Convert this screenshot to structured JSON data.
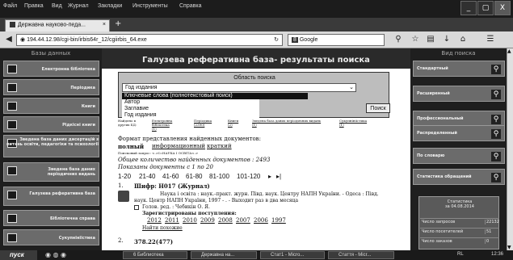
{
  "menubar": {
    "items": [
      "Файл",
      "Правка",
      "Вид",
      "Журнал",
      "Закладки",
      "Инструменты",
      "Справка"
    ],
    "window_buttons": [
      "_",
      "▢",
      "X"
    ]
  },
  "tabs": [
    {
      "label": "Державна науково-педа...",
      "close": "×"
    }
  ],
  "new_tab": "+",
  "address": {
    "url": "194.44.12.98/cgi-bin/irbis64r_12/cgiirbis_64.exe",
    "search_engine": "Google",
    "search_badge": "8"
  },
  "sidebar_left": {
    "title": "Базы данных",
    "items": [
      "Електронна бібліотека",
      "Періодика",
      "Книги",
      "Рідкісні книги",
      "Зведена база даних дисертацій з питань освіти, педагогіки та психології",
      "Зведена база даних періодичних видань",
      "Галузева реферативна база",
      "Бібліотечна справа",
      "Сукупнініістика"
    ]
  },
  "sidebar_right": {
    "title": "Вид поиска",
    "items": [
      "Стандартный",
      "Расширенный",
      "Профессиональный",
      "Распределенный",
      "По словарю",
      "Статистика обращений"
    ],
    "stats": {
      "heading": "Статистика",
      "date": "за 04.08.2014",
      "rows": [
        {
          "label": "Число запросов",
          "value": "22132"
        },
        {
          "label": "Число посетителей",
          "value": "51"
        },
        {
          "label": "Число заказов",
          "value": "0"
        }
      ]
    }
  },
  "main": {
    "title": "Галузева реферативна база- результаты поиска",
    "search_area_label": "Область поиска",
    "select_value": "Год издания",
    "dropdown_options": [
      "Ключевые слова (полнотекстовый поиск)",
      "Автор",
      "Заглавие",
      "Год издания"
    ],
    "search_button": "Поиск",
    "found_label": "Найдено в других БД:",
    "found_links": [
      {
        "name": "Електронна бібліотека",
        "count": "(1)"
      },
      {
        "name": "Періодика",
        "count": "(2390)"
      },
      {
        "name": "Книги",
        "count": "(2)"
      },
      {
        "name": "Зведена база даних періодичних видань",
        "count": "(1)"
      },
      {
        "name": "Сукупнініістика",
        "count": "(1)"
      }
    ],
    "format_label": "Формат представления найденных документов:",
    "formats": [
      "полный",
      "информационный",
      "краткий"
    ],
    "query_line": "Поисковый запрос: <.>I=НАУКА І ОСВІТА<.>",
    "total_line": "Общее количество найденных документов : 2493",
    "shown_line": "Показаны документы с 1 по 20",
    "pages": [
      "1-20",
      "21-40",
      "41-60",
      "61-80",
      "81-100",
      "101-120"
    ],
    "pages_next": "▸",
    "pages_last": "▸|",
    "record1": {
      "num": "1.",
      "code": "Шифр: Н017 (Журнал)",
      "line1": "Наука і освіта : наук.-практ. журн. Півд. наук. Центру НАПН України. - Одеса : Півд.",
      "line2": "наук. Центр НАПН України, 1997 - . - Выходит раз в два месяца",
      "line3": "Голов. ред. : Чебикін О. Я.",
      "line4": "Зарегистрированы поступления:",
      "years": [
        "2012",
        "2011",
        "2010",
        "2009",
        "2008",
        "2007",
        "2006",
        "1997"
      ],
      "similar": "Найти похожие"
    },
    "record2": {
      "num": "2.",
      "code": "378.22(477)"
    }
  },
  "taskbar": {
    "start": "пуск",
    "items": [
      "6 Библиотека",
      "Державна на...",
      "Стат1 - Micro...",
      "Стаття - Micr..."
    ],
    "clock": "12:36",
    "lang": "RL"
  }
}
